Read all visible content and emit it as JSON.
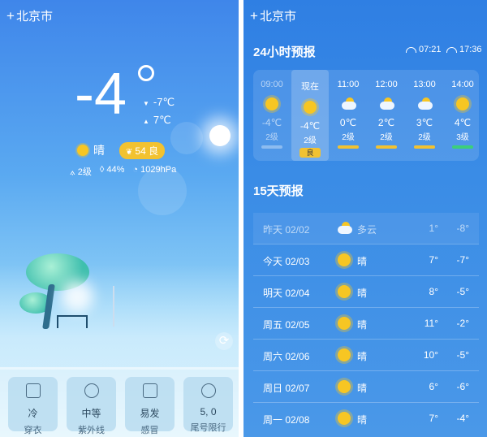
{
  "city": "北京市",
  "current": {
    "temp": "-4",
    "high": "-7℃",
    "low": "7℃",
    "condition": "晴",
    "aqi": "54 良",
    "wind": "2级",
    "humidity": "44%",
    "pressure": "1029hPa"
  },
  "life_cards": [
    {
      "value": "冷",
      "label": "穿衣",
      "icon": "shirt-icon"
    },
    {
      "value": "中等",
      "label": "紫外线",
      "icon": "sun-icon"
    },
    {
      "value": "易发",
      "label": "感冒",
      "icon": "medicine-icon"
    },
    {
      "value": "5, 0",
      "label": "尾号限行",
      "icon": "no-entry-icon"
    }
  ],
  "hourly_title": "24小时预报",
  "sunrise": "07:21",
  "sunset": "17:36",
  "hourly": [
    {
      "time": "09:00",
      "icon": "sun",
      "temp": "-4℃",
      "wind": "2级"
    },
    {
      "time": "现在",
      "icon": "sun",
      "temp": "-4℃",
      "wind": "2级",
      "badge": "良"
    },
    {
      "time": "11:00",
      "icon": "cloudy",
      "temp": "0℃",
      "wind": "2级"
    },
    {
      "time": "12:00",
      "icon": "cloudy",
      "temp": "2℃",
      "wind": "2级"
    },
    {
      "time": "13:00",
      "icon": "cloudy",
      "temp": "3℃",
      "wind": "2级"
    },
    {
      "time": "14:00",
      "icon": "sun",
      "temp": "4℃",
      "wind": "3级"
    }
  ],
  "daily_title": "15天预报",
  "daily": [
    {
      "day": "昨天 02/02",
      "icon": "cloudy",
      "cond": "多云",
      "high": "1°",
      "low": "-8°"
    },
    {
      "day": "今天 02/03",
      "icon": "sun",
      "cond": "晴",
      "high": "7°",
      "low": "-7°"
    },
    {
      "day": "明天 02/04",
      "icon": "sun",
      "cond": "晴",
      "high": "8°",
      "low": "-5°"
    },
    {
      "day": "周五 02/05",
      "icon": "sun",
      "cond": "晴",
      "high": "11°",
      "low": "-2°"
    },
    {
      "day": "周六 02/06",
      "icon": "sun",
      "cond": "晴",
      "high": "10°",
      "low": "-5°"
    },
    {
      "day": "周日 02/07",
      "icon": "sun",
      "cond": "晴",
      "high": "6°",
      "low": "-6°"
    },
    {
      "day": "周一 02/08",
      "icon": "sun",
      "cond": "晴",
      "high": "7°",
      "low": "-4°"
    }
  ]
}
